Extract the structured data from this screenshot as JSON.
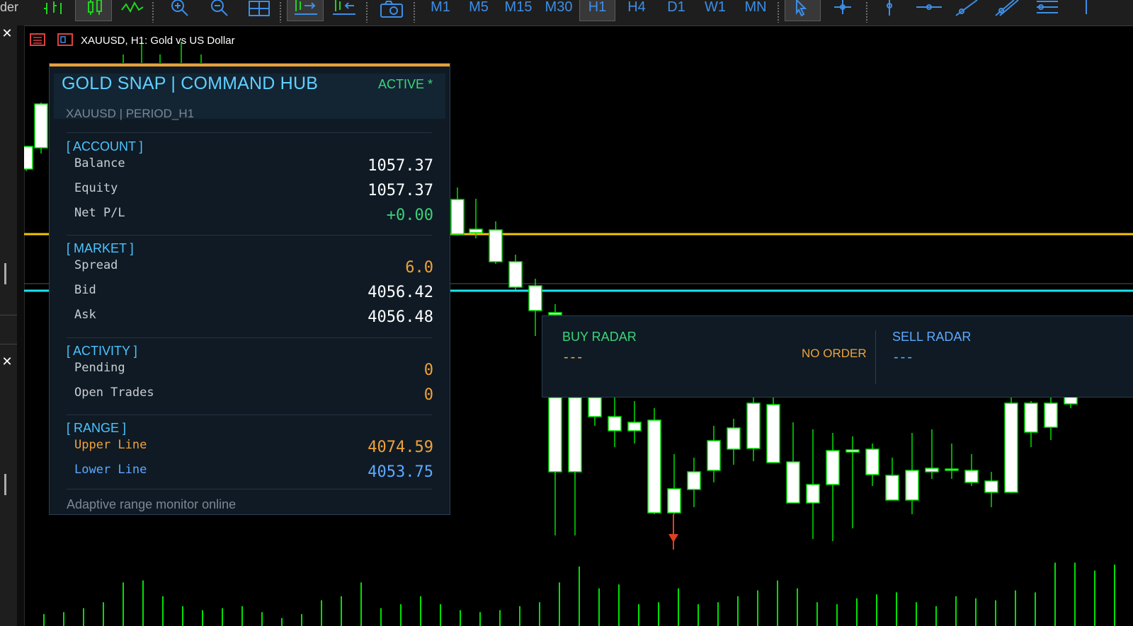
{
  "toolbar": {
    "partial_label": "der",
    "timeframes": [
      "M1",
      "M5",
      "M15",
      "M30",
      "H1",
      "H4",
      "D1",
      "W1",
      "MN"
    ],
    "active_timeframe": "H1"
  },
  "chart": {
    "title": "XAUUSD, H1:  Gold vs US Dollar",
    "upper_line_color": "#f5c400",
    "lower_line_color": "#1ee3f0",
    "candle_color": "#00e000"
  },
  "hub": {
    "title": "GOLD SNAP | COMMAND HUB",
    "status": "ACTIVE  *",
    "subtitle": "XAUUSD | PERIOD_H1",
    "account": {
      "header": "[ ACCOUNT ]",
      "balance_label": "Balance",
      "balance": "1057.37",
      "equity_label": "Equity",
      "equity": "1057.37",
      "netpl_label": "Net P/L",
      "netpl": "+0.00"
    },
    "market": {
      "header": "[ MARKET ]",
      "spread_label": "Spread",
      "spread": "6.0",
      "bid_label": "Bid",
      "bid": "4056.42",
      "ask_label": "Ask",
      "ask": "4056.48"
    },
    "activity": {
      "header": "[ ACTIVITY ]",
      "pending_label": "Pending",
      "pending": "0",
      "open_label": "Open Trades",
      "open": "0"
    },
    "range": {
      "header": "[ RANGE ]",
      "upper_label": "Upper Line",
      "upper": "4074.59",
      "lower_label": "Lower Line",
      "lower": "4053.75"
    },
    "footer": "Adaptive range monitor online"
  },
  "radar": {
    "buy_title": "BUY RADAR",
    "buy_value": "---",
    "buy_order": "NO ORDER",
    "sell_title": "SELL RADAR",
    "sell_value": "---"
  }
}
